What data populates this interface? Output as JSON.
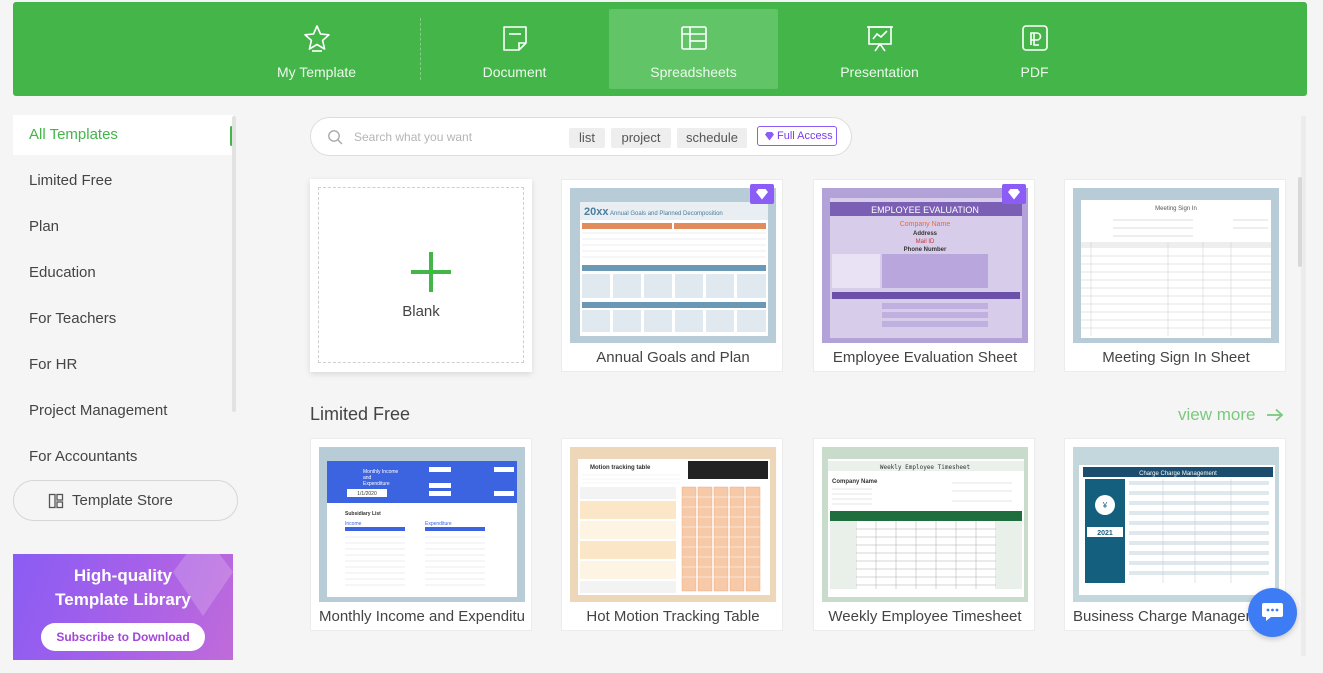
{
  "colors": {
    "brand_green": "#43b549",
    "premium_purple": "#8b5cf6",
    "chat_blue": "#3d7cf4"
  },
  "topnav": {
    "items": [
      {
        "label": "My Template",
        "icon": "star-icon",
        "active": false
      },
      {
        "label": "Document",
        "icon": "document-icon",
        "active": false
      },
      {
        "label": "Spreadsheets",
        "icon": "spreadsheet-icon",
        "active": true
      },
      {
        "label": "Presentation",
        "icon": "presentation-icon",
        "active": false
      },
      {
        "label": "PDF",
        "icon": "pdf-icon",
        "active": false
      }
    ]
  },
  "sidebar": {
    "items": [
      {
        "label": "All Templates",
        "active": true
      },
      {
        "label": "Limited Free"
      },
      {
        "label": "Plan"
      },
      {
        "label": "Education"
      },
      {
        "label": "For Teachers"
      },
      {
        "label": "For HR"
      },
      {
        "label": "Project Management"
      },
      {
        "label": "For Accountants"
      }
    ],
    "store_button": "Template Store"
  },
  "promo": {
    "line1": "High-quality",
    "line2": "Template Library",
    "button": "Subscribe to Download"
  },
  "search": {
    "placeholder": "Search what you want",
    "tags": [
      "list",
      "project",
      "schedule"
    ],
    "full_access": "Full Access"
  },
  "blank": {
    "label": "Blank"
  },
  "featured": [
    {
      "name": "Annual Goals and Plan",
      "premium": true,
      "thumb_title": "20xx Annual Goals and Planned Decomposition"
    },
    {
      "name": "Employee Evaluation Sheet",
      "premium": true,
      "thumb_title": "EMPLOYEE EVALUATION",
      "thumb_company": "Company Name",
      "thumb_address": "Address",
      "thumb_mail": "Mail ID",
      "thumb_phone": "Phone Number"
    },
    {
      "name": "Meeting Sign In Sheet",
      "premium": false,
      "thumb_title": "Meeting Sign In"
    }
  ],
  "limited_free": {
    "title": "Limited Free",
    "view_more": "view more",
    "items": [
      {
        "name": "Monthly Income and Expenditure",
        "thumb_title": "Monthly Income and Expenditure",
        "thumb_date": "1/1/2020",
        "thumb_sub": "Subsidiary List",
        "thumb_income": "Income",
        "thumb_exp": "Expenditure"
      },
      {
        "name": "Hot Motion Tracking Table",
        "thumb_title": "Motion tracking table"
      },
      {
        "name": "Weekly Employee Timesheet",
        "thumb_title": "Weekly Employee Timesheet",
        "thumb_company": "Company Name"
      },
      {
        "name": "Business Charge Management",
        "thumb_title": "Charge Charge Management",
        "thumb_year": "2021"
      }
    ]
  }
}
